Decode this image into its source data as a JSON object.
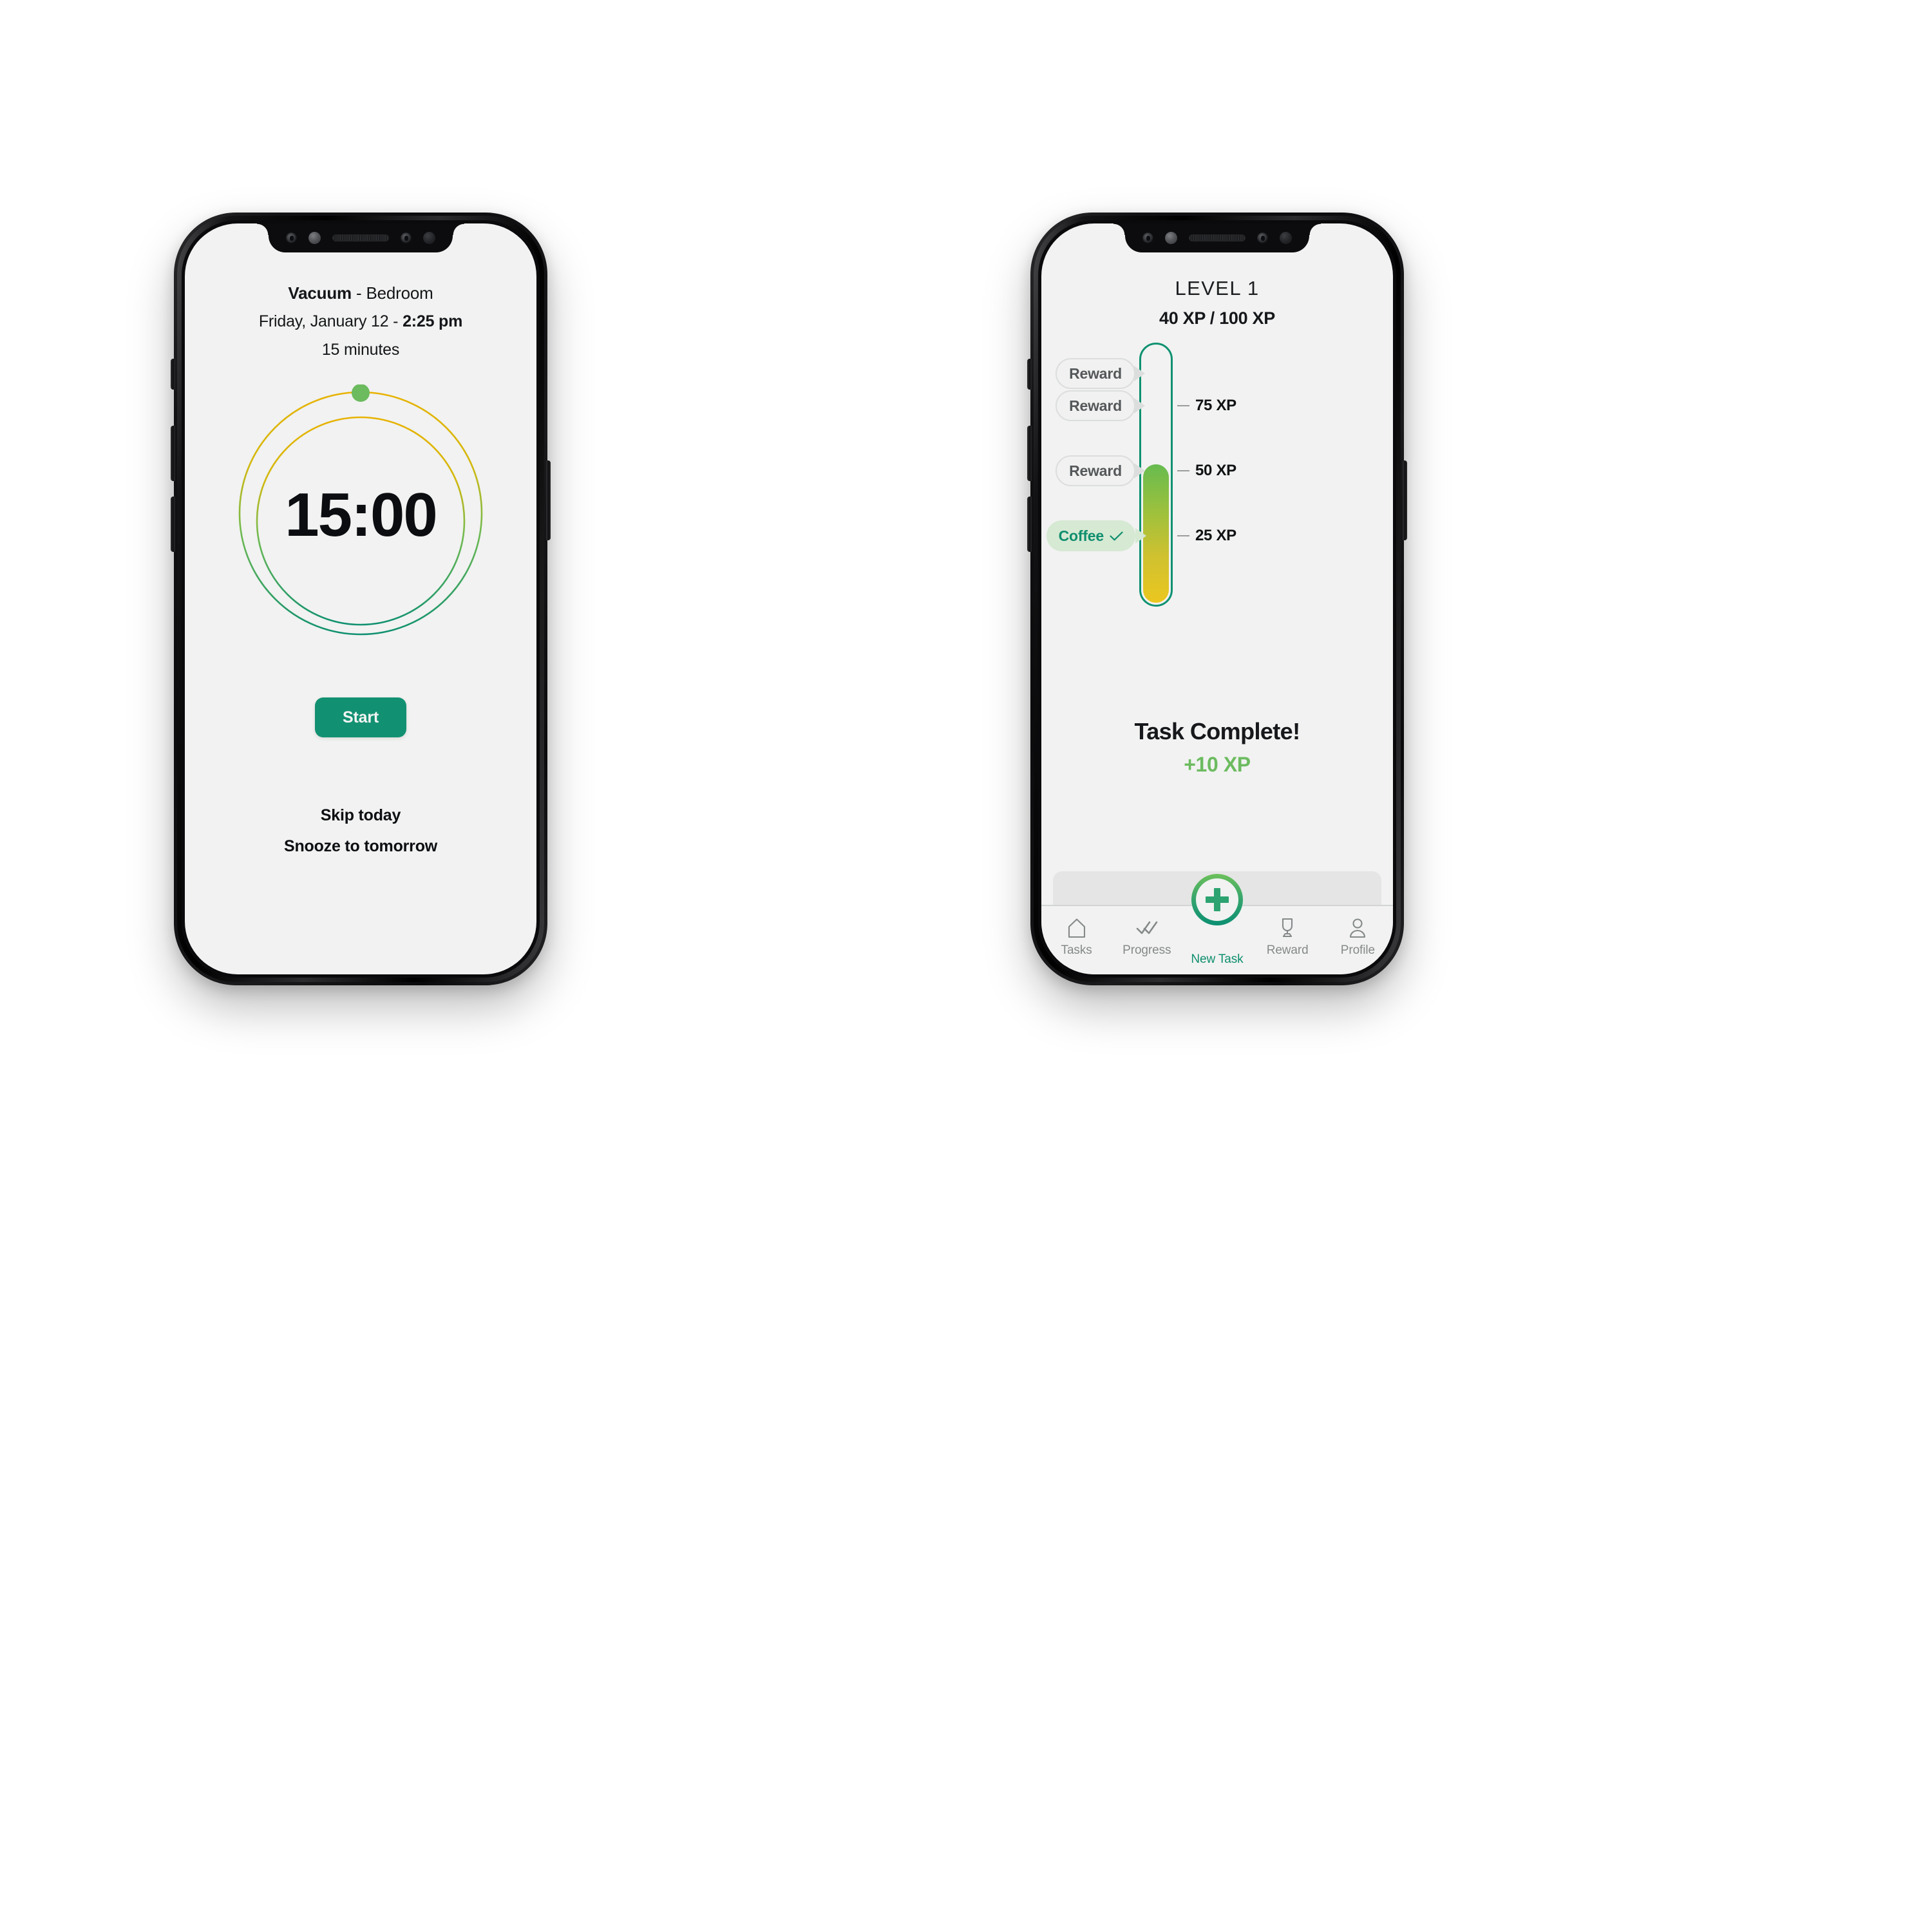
{
  "phone_left": {
    "header": {
      "task_name": "Vacuum",
      "task_separator": " - ",
      "task_location": "Bedroom",
      "date": "Friday, January 12 - ",
      "time": "2:25 pm",
      "duration": "15 minutes"
    },
    "timer": {
      "display": "15:00",
      "marker_color": "#6cbb5f",
      "ring_gradient_start": "#e8b200",
      "ring_gradient_end": "#0f9070"
    },
    "start_button": "Start",
    "skip_link": "Skip today",
    "snooze_link": "Snooze to tomorrow"
  },
  "phone_right": {
    "header": {
      "level": "LEVEL 1",
      "xp_progress": "40 XP / 100 XP"
    },
    "thermometer": {
      "outline_color": "#0e9171",
      "fill_top_color": "#67bb4f",
      "fill_bottom_color": "#ebc71f",
      "ticks": [
        {
          "label": "75 XP",
          "value": 75
        },
        {
          "label": "50 XP",
          "value": 50
        },
        {
          "label": "25 XP",
          "value": 25
        }
      ],
      "badges": [
        {
          "label": "Reward",
          "state": "locked",
          "checked": false
        },
        {
          "label": "Reward",
          "state": "locked",
          "checked": false
        },
        {
          "label": "Reward",
          "state": "locked",
          "checked": false
        },
        {
          "label": "Coffee",
          "state": "earned",
          "checked": true
        }
      ]
    },
    "status": {
      "title": "Task Complete!",
      "xp_gain": "+10 XP",
      "xp_gain_color": "#6cbb5f"
    },
    "nav": {
      "items": [
        {
          "label": "Tasks",
          "icon": "home-icon",
          "active": false
        },
        {
          "label": "Progress",
          "icon": "checks-icon",
          "active": false
        },
        {
          "label": "New Task",
          "icon": "plus-icon",
          "active": true
        },
        {
          "label": "Reward",
          "icon": "trophy-icon",
          "active": false
        },
        {
          "label": "Profile",
          "icon": "person-icon",
          "active": false
        }
      ]
    }
  },
  "chart_data": {
    "type": "bar",
    "title": "LEVEL 1",
    "subtitle": "40 XP / 100 XP",
    "ylabel": "XP",
    "ylim": [
      0,
      100
    ],
    "categories": [
      "XP"
    ],
    "values": [
      40
    ],
    "tick_values": [
      25,
      50,
      75
    ],
    "tick_labels": [
      "25 XP",
      "50 XP",
      "75 XP"
    ],
    "annotations": [
      "Reward",
      "Reward",
      "Reward",
      "Coffee"
    ],
    "grid": false,
    "legend": "none"
  }
}
